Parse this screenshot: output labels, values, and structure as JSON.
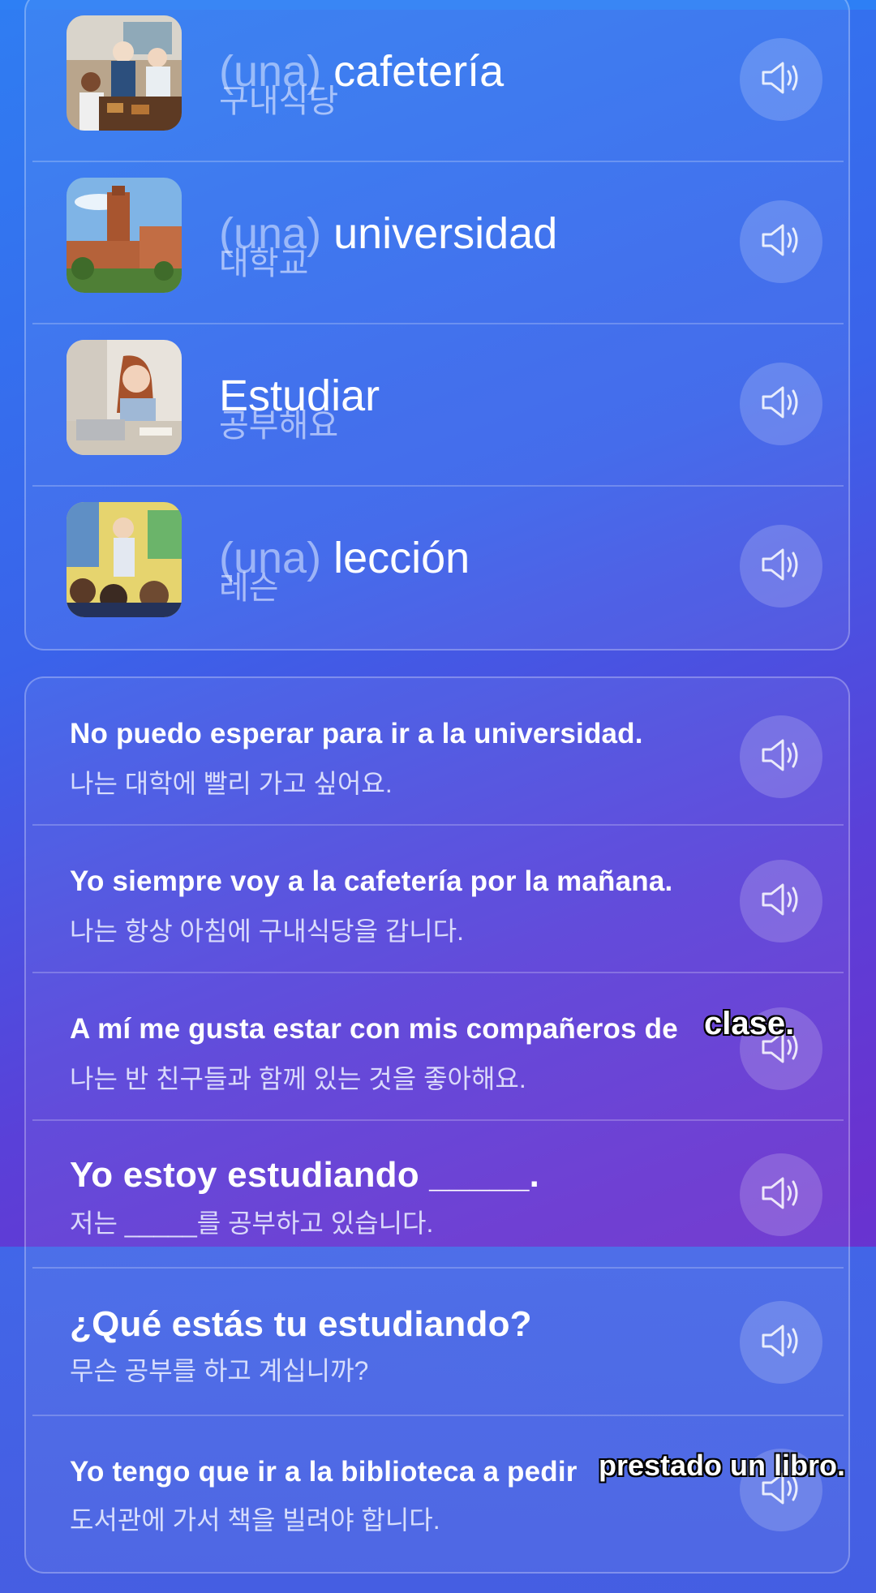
{
  "vocab": [
    {
      "article": "(una)",
      "word": "cafetería",
      "translation": "구내식당",
      "image": "cafeteria-photo"
    },
    {
      "article": "(una)",
      "word": "universidad",
      "translation": "대학교",
      "image": "university-photo"
    },
    {
      "article": "",
      "word": "Estudiar",
      "translation": "공부해요",
      "image": "studying-photo"
    },
    {
      "article": "(una)",
      "word": "lección",
      "translation": "레슨",
      "image": "classroom-photo"
    }
  ],
  "phrases": [
    {
      "es": "No puedo esperar para ir a la universidad.",
      "ko": "나는 대학에 빨리 가고 싶어요."
    },
    {
      "es": "Yo siempre voy a la cafetería por la mañana.",
      "ko": "나는 항상 아침에 구내식당을 갑니다."
    },
    {
      "es": "A mí me gusta estar con mis compañeros de",
      "ko": "나는 반 친구들과 함께 있는 것을 좋아해요.",
      "caption": "clase."
    },
    {
      "es": "Yo estoy estudiando _____.",
      "ko": "저는 _____를 공부하고 있습니다."
    },
    {
      "es": "¿Qué estás tu estudiando?",
      "ko": "무슨 공부를 하고 계십니까?"
    },
    {
      "es": "Yo tengo que ir a la biblioteca a pedir",
      "ko": "도서관에 가서 책을 빌려야 합니다.",
      "caption": "prestado un libro."
    }
  ],
  "icons": {
    "speaker": "speaker-icon"
  },
  "colors": {
    "accent": "#2f7df2",
    "purple": "#6a32cf"
  }
}
